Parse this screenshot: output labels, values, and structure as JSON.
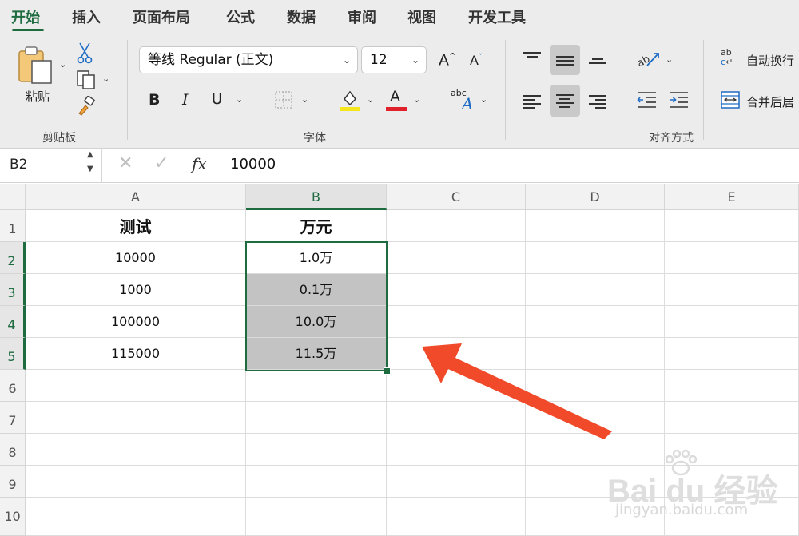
{
  "ribbon_tabs": [
    "开始",
    "插入",
    "页面布局",
    "公式",
    "数据",
    "审阅",
    "视图",
    "开发工具"
  ],
  "clipboard": {
    "paste_label": "粘贴",
    "group_label": "剪贴板"
  },
  "font": {
    "family_value": "等线 Regular (正文)",
    "size_value": "12",
    "group_label": "字体",
    "bold": "B",
    "italic": "I",
    "underline": "U",
    "grow": "A",
    "shrink": "A",
    "color_glyph": "A",
    "phonetic": "abc",
    "highlight_color": "#f5e51b",
    "font_color": "#e0212b"
  },
  "alignment": {
    "group_label": "对齐方式",
    "wrap_text": "自动换行",
    "merge_center": "合并后居"
  },
  "formula_bar": {
    "name_box": "B2",
    "fx": "fx",
    "value": "10000"
  },
  "sheet": {
    "columns": [
      "A",
      "B",
      "C",
      "D",
      "E"
    ],
    "rows": [
      "1",
      "2",
      "3",
      "4",
      "5",
      "6",
      "7",
      "8",
      "9",
      "10"
    ],
    "cells": {
      "A1": "测试",
      "B1": "万元",
      "A2": "10000",
      "B2": "1.0万",
      "A3": "1000",
      "B3": "0.1万",
      "A4": "100000",
      "B4": "10.0万",
      "A5": "115000",
      "B5": "11.5万"
    },
    "selection": "B2:B5"
  },
  "annotation": {
    "arrow_color": "#f04a2a"
  },
  "watermark": {
    "brand": "Bai du 经验",
    "url": "jingyan.baidu.com"
  },
  "colors": {
    "accent": "#1d6b3f",
    "selected_fill": "#c3c3c3"
  }
}
